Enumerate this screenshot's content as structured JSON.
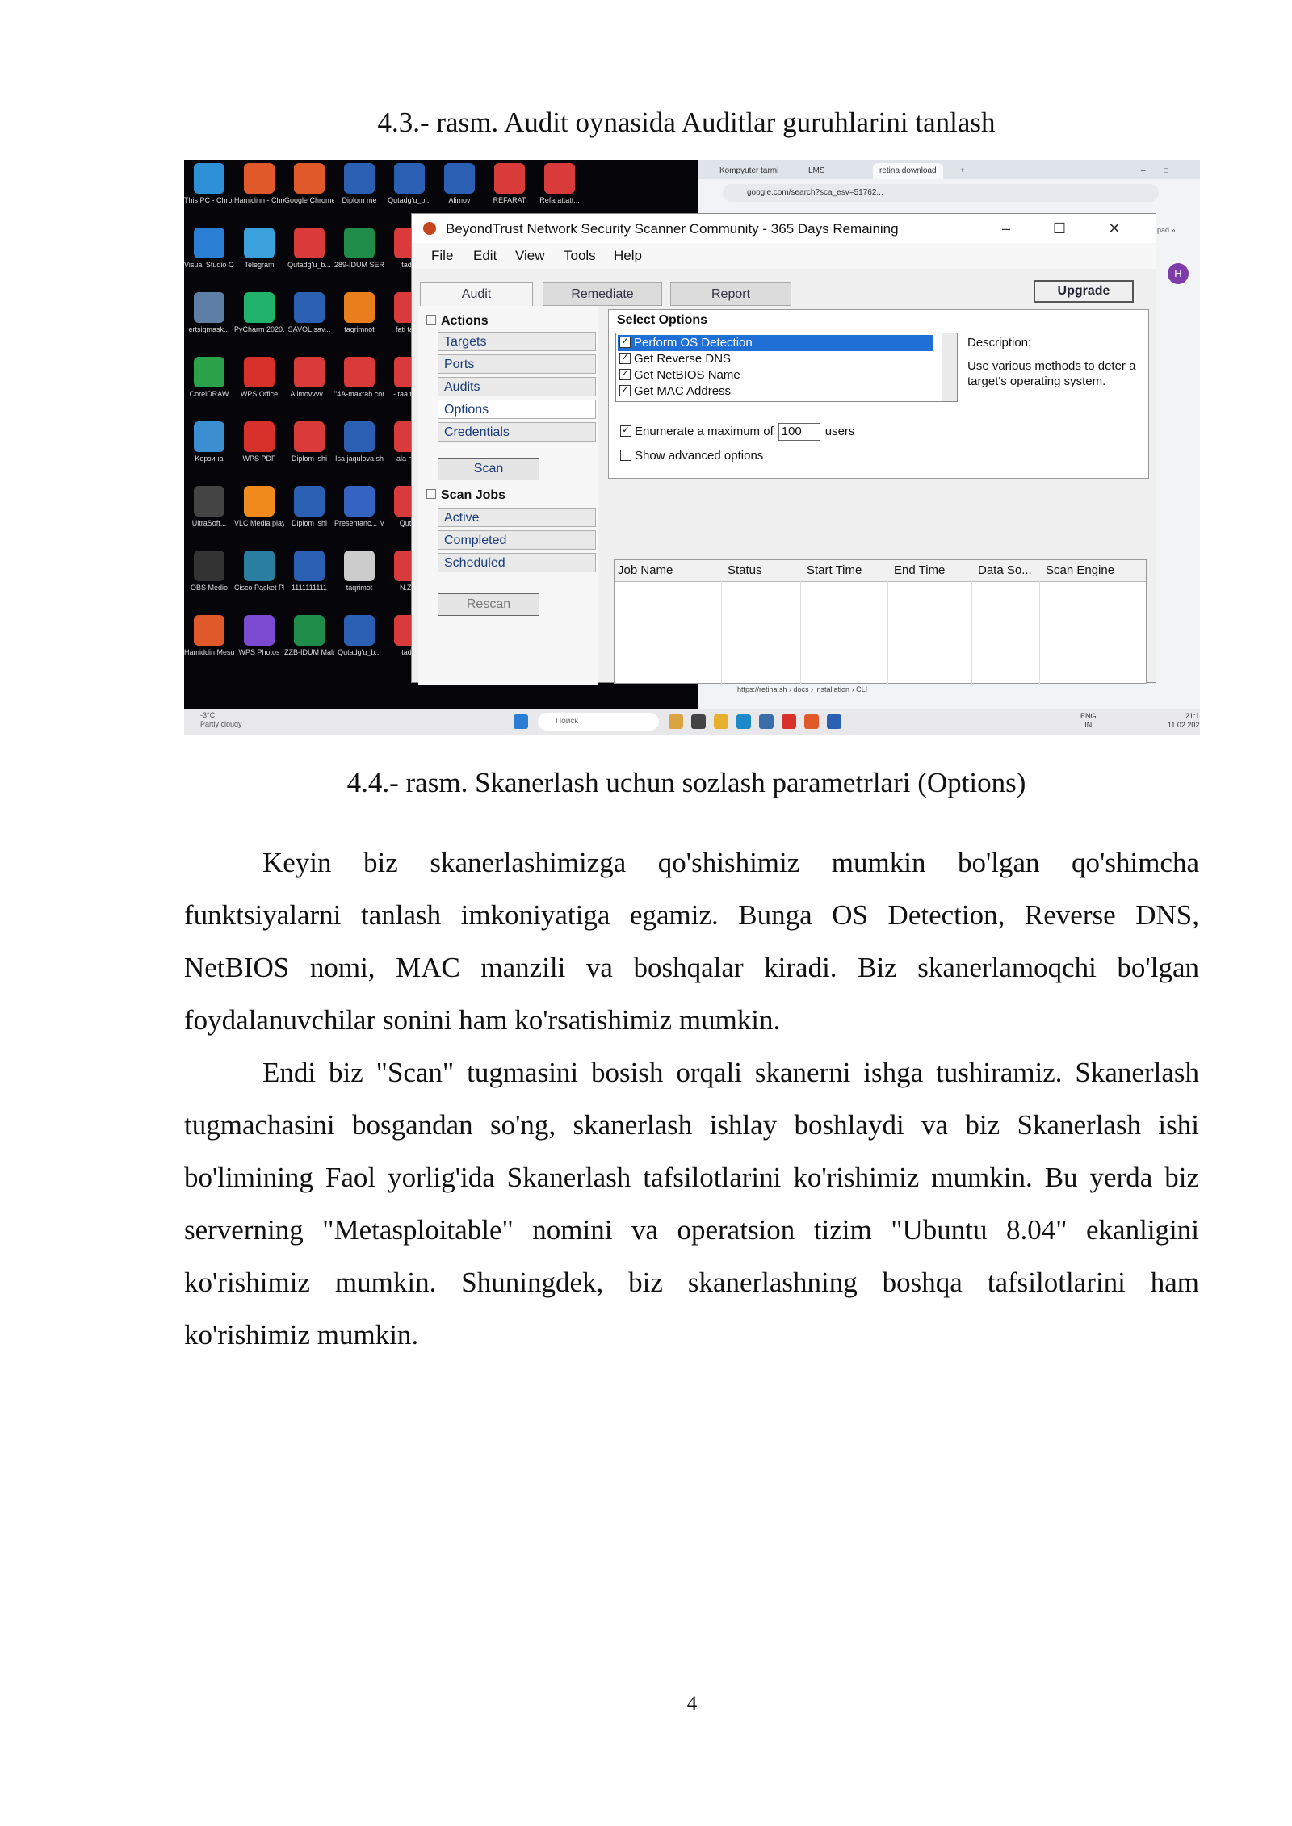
{
  "captions": {
    "top": "4.3.- rasm. Audit oynasida Auditlar guruhlarini tanlash",
    "bottom": "4.4.- rasm. Skanerlash uchun sozlash parametrlari (Options)"
  },
  "paragraphs": [
    "Keyin biz skanerlashimizga qo'shishimiz mumkin bo'lgan qo'shimcha funktsiyalarni tanlash imkoniyatiga egamiz. Bunga OS Detection, Reverse DNS, NetBIOS nomi, MAC manzili va boshqalar kiradi. Biz skanerlamoqchi bo'lgan foydalanuvchilar sonini ham ko'rsatishimiz mumkin.",
    "Endi biz \"Scan\" tugmasini bosish orqali skanerni ishga tushiramiz. Skanerlash tugmachasini bosgandan so'ng, skanerlash ishlay boshlaydi va biz Skanerlash ishi bo'limining Faol yorlig'ida Skanerlash tafsilotlarini ko'rishimiz mumkin. Bu yerda biz serverning \"Metasploitable\" nomini va operatsion tizim \"Ubuntu 8.04\" ekanligini ko'rishimiz mumkin. Shuningdek, biz skanerlashning boshqa tafsilotlarini ham ko'rishimiz mumkin."
  ],
  "page_number": "4",
  "desktop": {
    "icons": [
      {
        "label": "This PC - Chrome",
        "color": "#2d8fd6",
        "icon": "monitor-icon"
      },
      {
        "label": "Hamidinn - Chrome",
        "color": "#e0592a",
        "icon": "chrome-icon"
      },
      {
        "label": "Google Chrome",
        "color": "#e0592a",
        "icon": "chrome-icon"
      },
      {
        "label": "Diplom me",
        "color": "#2b5fb3",
        "icon": "word-icon"
      },
      {
        "label": "Qutadg'u_b...",
        "color": "#2b5fb3",
        "icon": "word-icon"
      },
      {
        "label": "Alimov",
        "color": "#2b5fb3",
        "icon": "word-icon"
      },
      {
        "label": "REFARAT",
        "color": "#d93b3b",
        "icon": "pdf-icon"
      },
      {
        "label": "Refarattatt...",
        "color": "#d93b3b",
        "icon": "pdf-icon"
      },
      {
        "label": "Visual Studio Code",
        "color": "#2a7fd4",
        "icon": "vscode-icon"
      },
      {
        "label": "Telegram",
        "color": "#3aa1dd",
        "icon": "telegram-icon"
      },
      {
        "label": "Qutadg'u_b...",
        "color": "#d93b3b",
        "icon": "pdf-icon"
      },
      {
        "label": "289-IDUM SERTIFICAT",
        "color": "#1f8c4a",
        "icon": "excel-icon"
      },
      {
        "label": "tadqi",
        "color": "#d93b3b",
        "icon": "pdf-icon"
      },
      {
        "label": "ertsigmask...",
        "color": "#5d7fa6",
        "icon": "app-icon"
      },
      {
        "label": "PyCharm 2020.17",
        "color": "#1fb36c",
        "icon": "pycharm-icon"
      },
      {
        "label": "SAVOL.sav...",
        "color": "#2b5fb3",
        "icon": "word-icon"
      },
      {
        "label": "taqrimnot",
        "color": "#e87f1c",
        "icon": "ppt-icon"
      },
      {
        "label": "fati tatqv",
        "color": "#d93b3b",
        "icon": "pdf-icon"
      },
      {
        "label": "CorelDRAW",
        "color": "#2aa24a",
        "icon": "corel-icon"
      },
      {
        "label": "WPS Office",
        "color": "#d8312c",
        "icon": "wps-icon"
      },
      {
        "label": "Alimovvvv...",
        "color": "#d93b3b",
        "icon": "pdf-icon"
      },
      {
        "label": "\"4A-maxrah commont...",
        "color": "#d93b3b",
        "icon": "pdf-icon"
      },
      {
        "label": "- taa tadqi",
        "color": "#d93b3b",
        "icon": "pdf-icon"
      },
      {
        "label": "Kopзина",
        "color": "#3b8fd0",
        "icon": "recycle-bin-icon"
      },
      {
        "label": "WPS PDF",
        "color": "#d8312c",
        "icon": "wps-pdf-icon"
      },
      {
        "label": "Diplom ishi",
        "color": "#d93b3b",
        "icon": "pdf-icon"
      },
      {
        "label": "Isa jaqulova.sh",
        "color": "#2b5fb3",
        "icon": "word-icon"
      },
      {
        "label": "ala hem",
        "color": "#d93b3b",
        "icon": "pdf-icon"
      },
      {
        "label": "UltraSoft...",
        "color": "#444444",
        "icon": "app-icon"
      },
      {
        "label": "VLC Media player",
        "color": "#f08a1c",
        "icon": "vlc-icon"
      },
      {
        "label": "Diplom ishi",
        "color": "#2b5fb3",
        "icon": "word-icon"
      },
      {
        "label": "Presentanc... Microsoft f...",
        "color": "#3463c2",
        "icon": "app-icon"
      },
      {
        "label": "Qutad",
        "color": "#d93b3b",
        "icon": "pdf-icon"
      },
      {
        "label": "OBS Medio",
        "color": "#333333",
        "icon": "obs-icon"
      },
      {
        "label": "Cisco Packet Player",
        "color": "#2a7fa0",
        "icon": "cisco-icon"
      },
      {
        "label": "1111111111",
        "color": "#2b5fb3",
        "icon": "word-icon"
      },
      {
        "label": "taqrimot",
        "color": "#cccccc",
        "icon": "app-icon"
      },
      {
        "label": "N.Zay",
        "color": "#d93b3b",
        "icon": "pdf-icon"
      },
      {
        "label": "Hamiddin Mesurda...",
        "color": "#e0592a",
        "icon": "chrome-icon"
      },
      {
        "label": "WPS Photos",
        "color": "#7a4bd1",
        "icon": "photos-icon"
      },
      {
        "label": "ZZB-IDUM Malumot",
        "color": "#1f8c4a",
        "icon": "excel-icon"
      },
      {
        "label": "Qutadg'u_b...",
        "color": "#2b5fb3",
        "icon": "word-icon"
      },
      {
        "label": "tadqi",
        "color": "#d93b3b",
        "icon": "pdf-icon"
      }
    ]
  },
  "browser": {
    "tabs": [
      "Kompyuter tarmi",
      "LMS",
      "retina download"
    ],
    "url": "google.com/search?sca_esv=51762...",
    "status_url": "https://retina.sh › docs › installation › CLI",
    "avatar": "H",
    "bookmark_more": "pad »"
  },
  "app": {
    "title": "BeyondTrust Network Security Scanner Community - 365 Days Remaining",
    "menu": [
      "File",
      "Edit",
      "View",
      "Tools",
      "Help"
    ],
    "tabs": [
      "Audit",
      "Remediate",
      "Report"
    ],
    "upgrade": "Upgrade",
    "actions_head": "Actions",
    "actions": [
      "Targets",
      "Ports",
      "Audits",
      "Options",
      "Credentials"
    ],
    "scan_button": "Scan",
    "scan_jobs_head": "Scan Jobs",
    "scan_jobs": [
      "Active",
      "Completed",
      "Scheduled"
    ],
    "rescan_button": "Rescan",
    "select_options": "Select Options",
    "options": [
      {
        "label": "Perform OS Detection",
        "checked": true,
        "selected": true
      },
      {
        "label": "Get Reverse DNS",
        "checked": true,
        "selected": false
      },
      {
        "label": "Get NetBIOS Name",
        "checked": true,
        "selected": false
      },
      {
        "label": "Get MAC Address",
        "checked": true,
        "selected": false
      }
    ],
    "description_head": "Description:",
    "description_text": "Use various methods to deter a target's operating system.",
    "enumerate_label": "Enumerate a maximum of",
    "enumerate_value": "100",
    "enumerate_unit": "users",
    "show_advanced": "Show advanced options",
    "job_columns": [
      "Job Name",
      "Status",
      "Start Time",
      "End Time",
      "Data So...",
      "Scan Engine"
    ]
  },
  "taskbar": {
    "weather_temp": "-3°C",
    "weather_desc": "Partly cloudy",
    "search_placeholder": "Поиск",
    "lang": "ENG",
    "lang_sub": "IN",
    "time": "21:1",
    "date": "11.02.202"
  }
}
